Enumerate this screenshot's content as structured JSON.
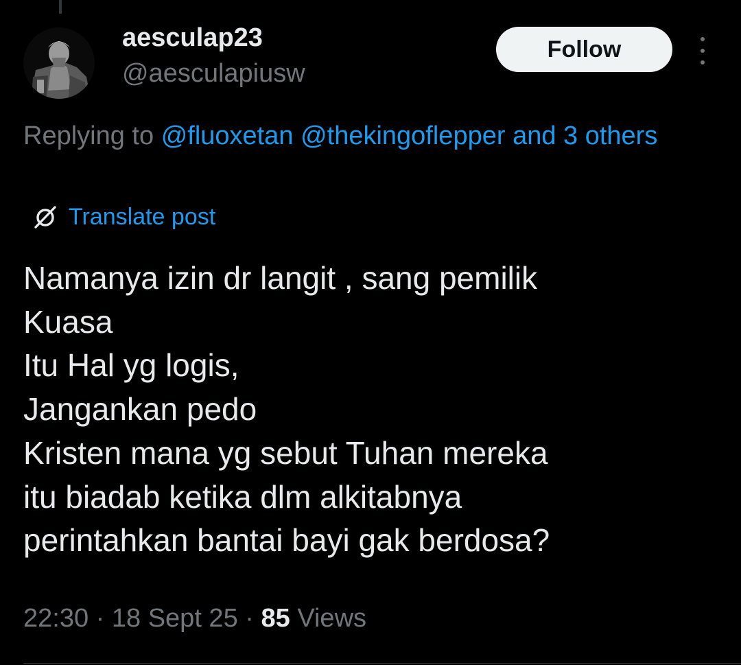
{
  "author": {
    "display_name": "aesculap23",
    "handle": "@aesculapiusw",
    "avatar_icon": "user-avatar-photo"
  },
  "follow_button": {
    "label": "Follow"
  },
  "more_menu": {
    "icon": "more-vertical-icon"
  },
  "reply_context": {
    "prefix": "Replying to",
    "mentions": [
      "@fluoxetan",
      "@thekingoflepper"
    ],
    "others_text": "and 3 others"
  },
  "translate": {
    "icon": "translate-icon",
    "label": "Translate post"
  },
  "post": {
    "lines": [
      "Namanya izin dr langit , sang pemilik",
      "Kuasa",
      "Itu Hal yg logis,",
      "Jangankan pedo",
      "Kristen mana yg sebut Tuhan mereka",
      "itu biadab ketika dlm alkitabnya",
      "perintahkan bantai bayi gak berdosa?"
    ]
  },
  "meta": {
    "time": "22:30",
    "separator": "·",
    "date": "18 Sept 25",
    "views_count": "85",
    "views_label": "Views"
  },
  "colors": {
    "background": "#000000",
    "primary_text": "#e7e9ea",
    "secondary_text": "#71767b",
    "link": "#1d9bf0",
    "button_bg": "#eff3f4"
  }
}
